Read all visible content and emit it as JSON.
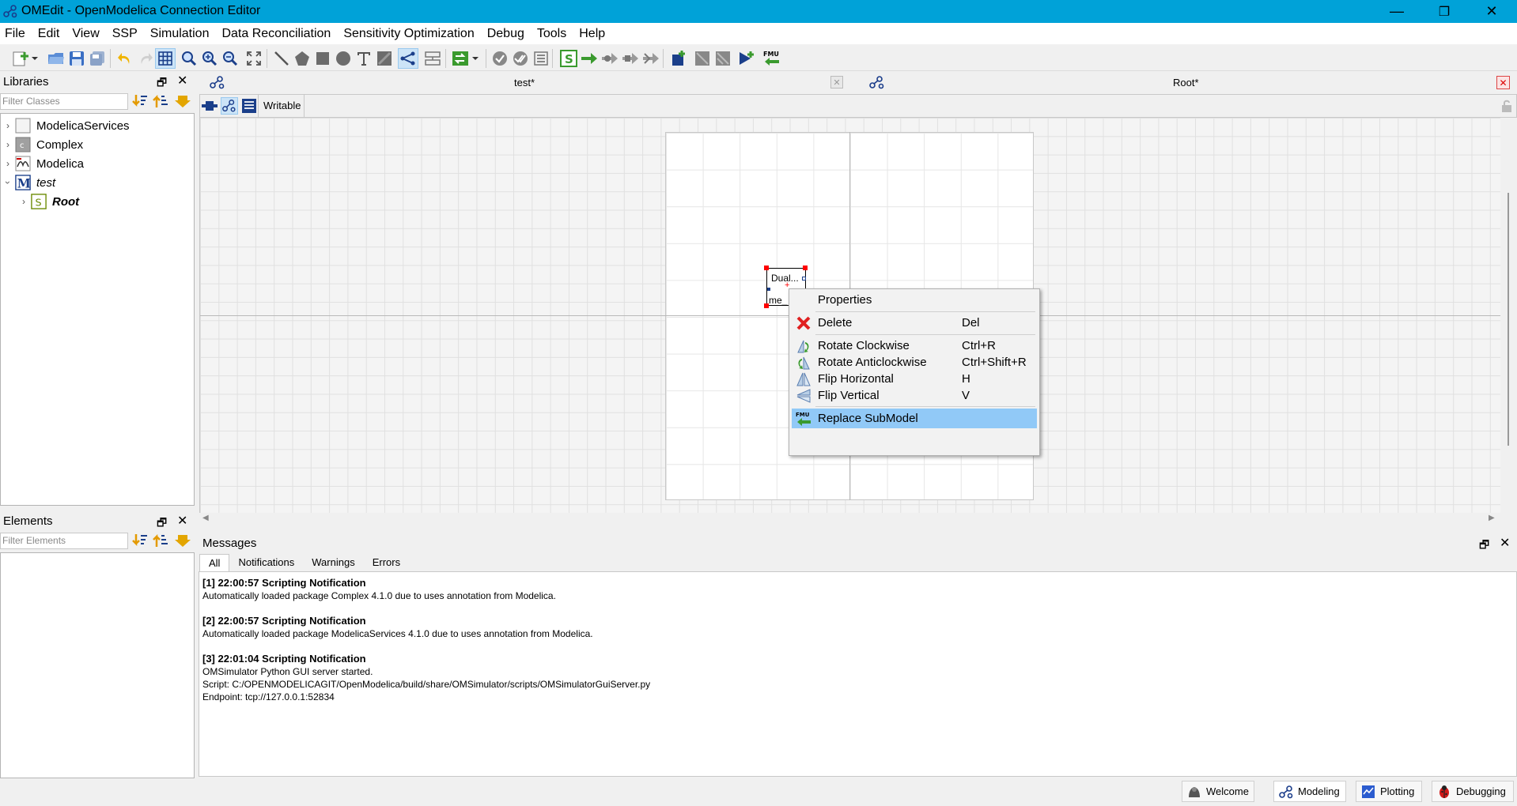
{
  "window": {
    "title": "OMEdit - OpenModelica Connection Editor",
    "minimize": "—",
    "restore": "❐",
    "close": "✕"
  },
  "menu": [
    "File",
    "Edit",
    "View",
    "SSP",
    "Simulation",
    "Data Reconciliation",
    "Sensitivity Optimization",
    "Debug",
    "Tools",
    "Help"
  ],
  "libraries": {
    "title": "Libraries",
    "filter_placeholder": "Filter Classes",
    "items": [
      {
        "label": "ModelicaServices",
        "icon": "package-icon"
      },
      {
        "label": "Complex",
        "icon": "record-icon"
      },
      {
        "label": "Modelica",
        "icon": "modelica-icon"
      },
      {
        "label": "test",
        "icon": "model-m-icon"
      },
      {
        "label": "Root",
        "icon": "system-s-icon"
      }
    ]
  },
  "elements": {
    "title": "Elements",
    "filter_placeholder": "Filter Elements"
  },
  "tabs": {
    "test_title": "test*",
    "root_title": "Root*"
  },
  "modelbar": {
    "writable": "Writable"
  },
  "component": {
    "name_top": "Dual...",
    "name_bottom": "me_"
  },
  "context_menu": [
    {
      "label": "Properties",
      "shortcut": "",
      "icon": ""
    },
    {
      "label": "Delete",
      "shortcut": "Del",
      "icon": "delete-icon"
    },
    {
      "label": "Rotate Clockwise",
      "shortcut": "Ctrl+R",
      "icon": "rotate-clockwise-icon"
    },
    {
      "label": "Rotate Anticlockwise",
      "shortcut": "Ctrl+Shift+R",
      "icon": "rotate-anticlockwise-icon"
    },
    {
      "label": "Flip Horizontal",
      "shortcut": "H",
      "icon": "flip-horizontal-icon"
    },
    {
      "label": "Flip Vertical",
      "shortcut": "V",
      "icon": "flip-vertical-icon"
    },
    {
      "label": "Replace SubModel",
      "shortcut": "",
      "icon": "fmu-replace-icon"
    }
  ],
  "messages": {
    "title": "Messages",
    "tabs": [
      "All",
      "Notifications",
      "Warnings",
      "Errors"
    ],
    "entries": [
      {
        "header": "[1] 22:00:57 Scripting Notification",
        "lines": [
          "Automatically loaded package Complex 4.1.0 due to uses annotation from Modelica."
        ]
      },
      {
        "header": "[2] 22:00:57 Scripting Notification",
        "lines": [
          "Automatically loaded package ModelicaServices 4.1.0 due to uses annotation from Modelica."
        ]
      },
      {
        "header": "[3] 22:01:04 Scripting Notification",
        "lines": [
          "OMSimulator Python GUI server started.",
          "Script: C:/OPENMODELICAGIT/OpenModelica/build/share/OMSimulator/scripts/OMSimulatorGuiServer.py",
          "Endpoint: tcp://127.0.0.1:52834"
        ]
      }
    ]
  },
  "perspectives": [
    "Welcome",
    "Modeling",
    "Plotting",
    "Debugging"
  ]
}
